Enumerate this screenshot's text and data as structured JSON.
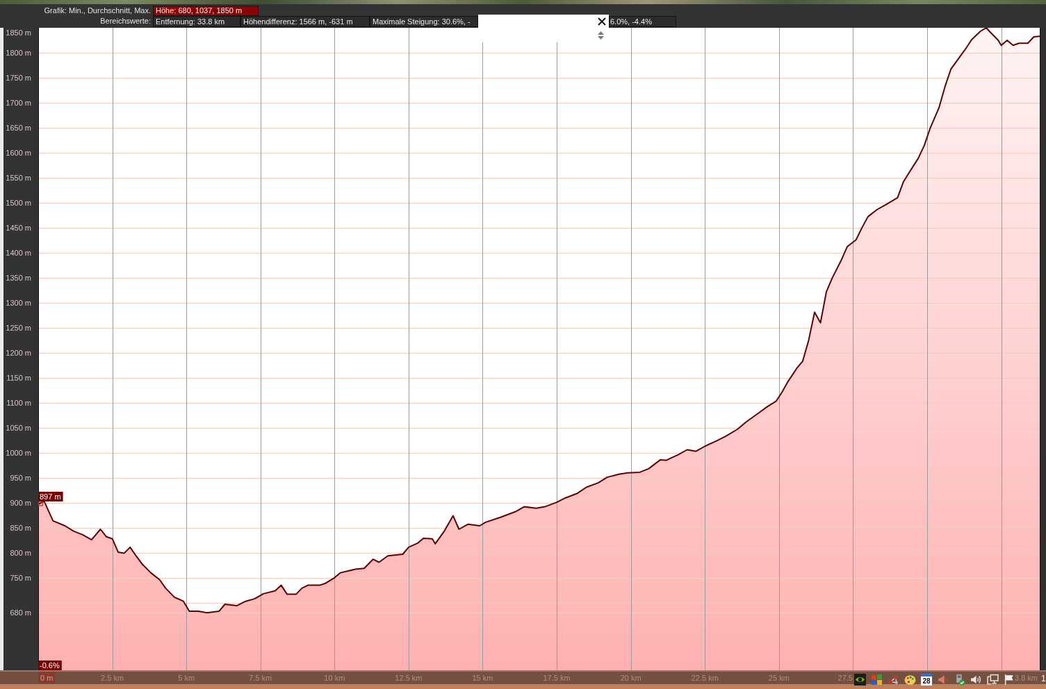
{
  "header": {
    "graph_label": "Grafik: Min., Durchschnitt, Max.",
    "elevation_summary": "Höhe: 680, 1037, 1850 m",
    "range_label": "Bereichswerte:",
    "range_values": [
      "Entfernung: 33.8 km",
      "Höhendifferenz: 1566 m, -631 m",
      "Maximale Steigung: 30.6%, -",
      "6.0%, -4.4%"
    ]
  },
  "chart": {
    "chart_data": {
      "type": "area",
      "x": [
        0,
        0.2,
        0.5,
        0.9,
        1.2,
        1.5,
        1.8,
        2.1,
        2.3,
        2.5,
        2.7,
        2.9,
        3.1,
        3.3,
        3.5,
        3.8,
        4.1,
        4.3,
        4.6,
        4.9,
        5.1,
        5.4,
        5.7,
        6.1,
        6.3,
        6.7,
        7.0,
        7.3,
        7.6,
        8.0,
        8.2,
        8.4,
        8.7,
        8.9,
        9.1,
        9.5,
        9.7,
        10.0,
        10.2,
        10.7,
        11.0,
        11.3,
        11.5,
        11.8,
        12.3,
        12.5,
        12.8,
        13.0,
        13.3,
        13.4,
        13.7,
        14.0,
        14.2,
        14.5,
        14.9,
        15.1,
        15.6,
        16.1,
        16.4,
        16.8,
        17.1,
        17.5,
        17.8,
        18.2,
        18.5,
        18.9,
        19.2,
        19.6,
        19.9,
        20.3,
        20.6,
        21.0,
        21.2,
        21.6,
        21.9,
        22.2,
        22.5,
        22.9,
        23.2,
        23.6,
        23.9,
        24.3,
        24.6,
        24.9,
        25.1,
        25.3,
        25.6,
        25.8,
        26.0,
        26.2,
        26.4,
        26.6,
        26.8,
        27.1,
        27.3,
        27.6,
        27.8,
        28.0,
        28.3,
        28.6,
        29.0,
        29.2,
        29.4,
        29.7,
        29.9,
        30.1,
        30.4,
        30.6,
        30.8,
        31.1,
        31.3,
        31.5,
        31.8,
        32.0,
        32.1,
        32.4,
        32.5,
        32.7,
        32.9,
        33.1,
        33.4,
        33.6,
        33.8
      ],
      "series": [
        {
          "color": "#5c0000",
          "values": [
            897,
            903,
            864,
            854,
            843,
            836,
            826,
            847,
            832,
            828,
            801,
            799,
            811,
            794,
            778,
            760,
            746,
            729,
            711,
            703,
            683,
            683,
            680,
            683,
            697,
            694,
            703,
            708,
            718,
            724,
            735,
            717,
            717,
            729,
            735,
            735,
            739,
            750,
            760,
            767,
            769,
            787,
            781,
            794,
            797,
            811,
            819,
            829,
            828,
            818,
            843,
            874,
            847,
            857,
            854,
            861,
            871,
            882,
            892,
            889,
            892,
            901,
            910,
            919,
            931,
            940,
            951,
            957,
            960,
            961,
            968,
            986,
            985,
            996,
            1006,
            1003,
            1013,
            1024,
            1033,
            1047,
            1062,
            1079,
            1092,
            1103,
            1121,
            1142,
            1169,
            1183,
            1225,
            1281,
            1260,
            1322,
            1350,
            1385,
            1412,
            1426,
            1450,
            1472,
            1486,
            1496,
            1510,
            1542,
            1561,
            1589,
            1614,
            1649,
            1690,
            1732,
            1767,
            1792,
            1808,
            1826,
            1843,
            1850,
            1843,
            1825,
            1815,
            1825,
            1815,
            1819,
            1819,
            1832,
            1833
          ]
        }
      ],
      "xlim": [
        0,
        33.8
      ],
      "ylim": [
        565,
        1850
      ],
      "grid": true,
      "xticks": [
        {
          "value": 0,
          "label": "0 m"
        },
        {
          "value": 2.5,
          "label": "2.5 km"
        },
        {
          "value": 5,
          "label": "5 km"
        },
        {
          "value": 7.5,
          "label": "7.5 km"
        },
        {
          "value": 10,
          "label": "10 km"
        },
        {
          "value": 12.5,
          "label": "12.5 km"
        },
        {
          "value": 15,
          "label": "15 km"
        },
        {
          "value": 17.5,
          "label": "17.5 km"
        },
        {
          "value": 20,
          "label": "20 km"
        },
        {
          "value": 22.5,
          "label": "22.5 km"
        },
        {
          "value": 25,
          "label": "25 km"
        }
      ],
      "yticks": [
        {
          "value": 680,
          "label": "680 m"
        },
        {
          "value": 750,
          "label": "750 m"
        },
        {
          "value": 800,
          "label": "800 m"
        },
        {
          "value": 850,
          "label": "850 m"
        },
        {
          "value": 900,
          "label": "900 m"
        },
        {
          "value": 950,
          "label": "950 m"
        },
        {
          "value": 1000,
          "label": "1000 m"
        },
        {
          "value": 1050,
          "label": "1050 m"
        },
        {
          "value": 1100,
          "label": "1100 m"
        },
        {
          "value": 1150,
          "label": "1150 m"
        },
        {
          "value": 1200,
          "label": "1200 m"
        },
        {
          "value": 1250,
          "label": "1250 m"
        },
        {
          "value": 1300,
          "label": "1300 m"
        },
        {
          "value": 1350,
          "label": "1350 m"
        },
        {
          "value": 1400,
          "label": "1400 m"
        },
        {
          "value": 1450,
          "label": "1450 m"
        },
        {
          "value": 1500,
          "label": "1500 m"
        },
        {
          "value": 1550,
          "label": "1550 m"
        },
        {
          "value": 1600,
          "label": "1600 m"
        },
        {
          "value": 1650,
          "label": "1650 m"
        },
        {
          "value": 1700,
          "label": "1700 m"
        },
        {
          "value": 1750,
          "label": "1750 m"
        },
        {
          "value": 1800,
          "label": "1800 m"
        },
        {
          "value": 1850,
          "label": "1850 m"
        }
      ],
      "annotations": [
        {
          "x": 0,
          "y": 897,
          "text": "897 m"
        }
      ]
    },
    "grade_readout": "-0.6%",
    "partial_x_labels": [
      "27.5",
      "3.8 km"
    ]
  },
  "taskbar": {
    "calendar_day": "28",
    "clock": "1"
  }
}
